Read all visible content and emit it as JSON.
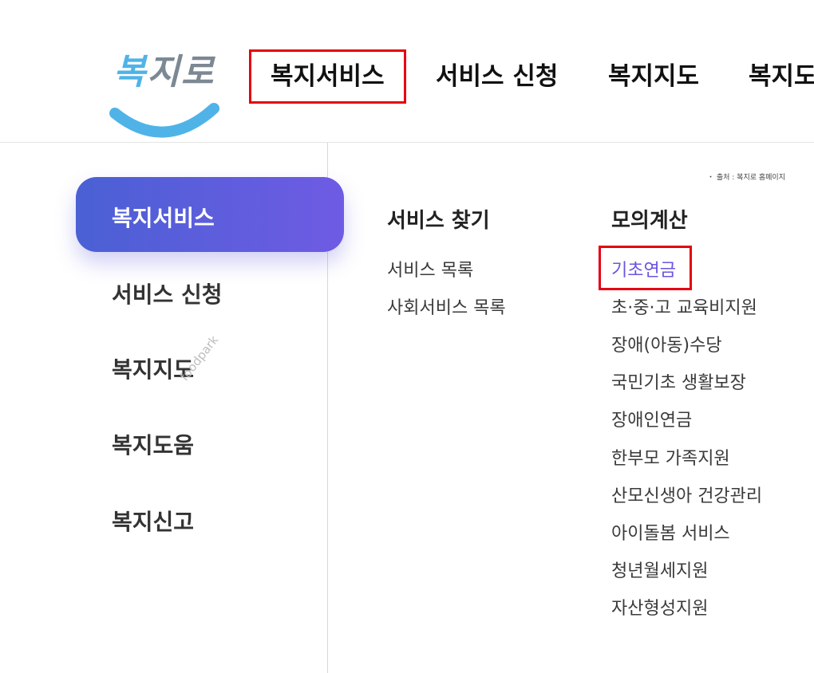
{
  "logo": {
    "first": "복",
    "rest": "지로"
  },
  "gnb": {
    "items": [
      {
        "label": "복지서비스"
      },
      {
        "label": "서비스 신청"
      },
      {
        "label": "복지지도"
      },
      {
        "label": "복지도"
      }
    ]
  },
  "side_menu": {
    "items": [
      {
        "label": "복지서비스"
      },
      {
        "label": "서비스 신청"
      },
      {
        "label": "복지지도"
      },
      {
        "label": "복지도움"
      },
      {
        "label": "복지신고"
      }
    ]
  },
  "watermark": "foodpark",
  "source_note": "・ 출처 : 복지로 홈페이지",
  "columns": [
    {
      "title": "서비스 찾기",
      "links": [
        {
          "label": "서비스 목록"
        },
        {
          "label": "사회서비스 목록"
        }
      ]
    },
    {
      "title": "모의계산",
      "links": [
        {
          "label": "기초연금"
        },
        {
          "label": "초·중·고 교육비지원"
        },
        {
          "label": "장애(아동)수당"
        },
        {
          "label": "국민기초 생활보장"
        },
        {
          "label": "장애인연금"
        },
        {
          "label": "한부모 가족지원"
        },
        {
          "label": "산모신생아 건강관리"
        },
        {
          "label": "아이돌봄 서비스"
        },
        {
          "label": "청년월세지원"
        },
        {
          "label": "자산형성지원"
        }
      ]
    }
  ],
  "colors": {
    "accent": "#6a55e0",
    "highlight_border": "#e60012",
    "logo_blue": "#4fb3e8"
  }
}
